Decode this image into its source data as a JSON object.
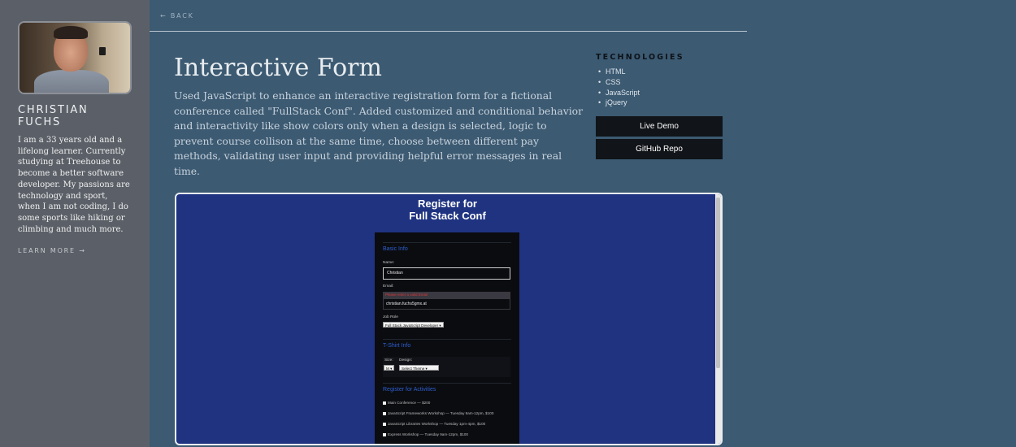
{
  "sidebar": {
    "name": "CHRISTIAN FUCHS",
    "bio": "I am a 33 years old and a lifelong learner. Currently studying at Treehouse to become a better software developer. My passions are technology and sport, when I am not coding, I do some sports like hiking or climbing and much more.",
    "learn_more": "LEARN MORE →"
  },
  "nav": {
    "back": "← BACK"
  },
  "project": {
    "title": "Interactive Form",
    "description": "Used JavaScript to enhance an interactive registration form for a fictional conference called \"FullStack Conf\". Added customized and conditional behavior and interactivity like show colors only when a design is selected, logic to prevent course collison at the same time, choose between different pay methods, validating user input and providing helpful error messages in real time."
  },
  "technologies": {
    "heading": "TECHNOLOGIES",
    "items": [
      "HTML",
      "CSS",
      "JavaScript",
      "jQuery"
    ]
  },
  "buttons": {
    "live_demo": "Live Demo",
    "github_repo": "GitHub Repo"
  },
  "preview": {
    "title_line1": "Register for",
    "title_line2": "Full Stack Conf",
    "basic_info": "Basic Info",
    "name_label": "Name:",
    "name_value": "Christian",
    "email_label": "Email:",
    "email_error": "Please enter a valid Email",
    "email_value": "christian.fuchs5gmx.at",
    "job_label": "Job Role",
    "job_value": "Full Stack JavaScript Developer ▾",
    "tshirt_info": "T-Shirt Info",
    "size_label": "Size:",
    "size_value": "M ▾",
    "design_label": "Design:",
    "design_value": "Select Theme ▾",
    "activities": "Register for Activities",
    "activity_items": [
      "Main Conference — $200",
      "JavaScript Frameworks Workshop — Tuesday 9am-12pm, $100",
      "JavaScript Libraries Workshop — Tuesday 1pm-4pm, $100",
      "Express Workshop — Tuesday 9am-12pm, $100"
    ]
  }
}
